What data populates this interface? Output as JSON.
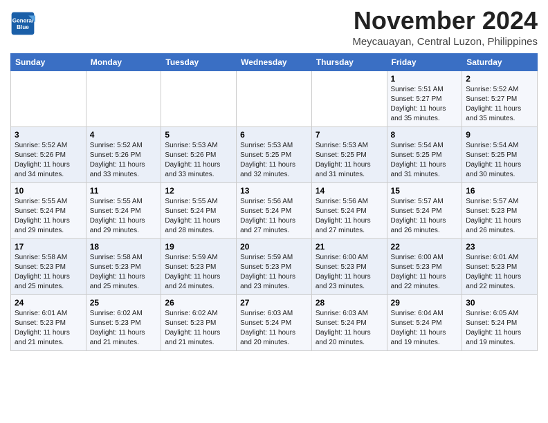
{
  "logo": {
    "line1": "General",
    "line2": "Blue"
  },
  "title": "November 2024",
  "subtitle": "Meycauayan, Central Luzon, Philippines",
  "weekdays": [
    "Sunday",
    "Monday",
    "Tuesday",
    "Wednesday",
    "Thursday",
    "Friday",
    "Saturday"
  ],
  "weeks": [
    [
      {
        "day": "",
        "info": ""
      },
      {
        "day": "",
        "info": ""
      },
      {
        "day": "",
        "info": ""
      },
      {
        "day": "",
        "info": ""
      },
      {
        "day": "",
        "info": ""
      },
      {
        "day": "1",
        "info": "Sunrise: 5:51 AM\nSunset: 5:27 PM\nDaylight: 11 hours\nand 35 minutes."
      },
      {
        "day": "2",
        "info": "Sunrise: 5:52 AM\nSunset: 5:27 PM\nDaylight: 11 hours\nand 35 minutes."
      }
    ],
    [
      {
        "day": "3",
        "info": "Sunrise: 5:52 AM\nSunset: 5:26 PM\nDaylight: 11 hours\nand 34 minutes."
      },
      {
        "day": "4",
        "info": "Sunrise: 5:52 AM\nSunset: 5:26 PM\nDaylight: 11 hours\nand 33 minutes."
      },
      {
        "day": "5",
        "info": "Sunrise: 5:53 AM\nSunset: 5:26 PM\nDaylight: 11 hours\nand 33 minutes."
      },
      {
        "day": "6",
        "info": "Sunrise: 5:53 AM\nSunset: 5:25 PM\nDaylight: 11 hours\nand 32 minutes."
      },
      {
        "day": "7",
        "info": "Sunrise: 5:53 AM\nSunset: 5:25 PM\nDaylight: 11 hours\nand 31 minutes."
      },
      {
        "day": "8",
        "info": "Sunrise: 5:54 AM\nSunset: 5:25 PM\nDaylight: 11 hours\nand 31 minutes."
      },
      {
        "day": "9",
        "info": "Sunrise: 5:54 AM\nSunset: 5:25 PM\nDaylight: 11 hours\nand 30 minutes."
      }
    ],
    [
      {
        "day": "10",
        "info": "Sunrise: 5:55 AM\nSunset: 5:24 PM\nDaylight: 11 hours\nand 29 minutes."
      },
      {
        "day": "11",
        "info": "Sunrise: 5:55 AM\nSunset: 5:24 PM\nDaylight: 11 hours\nand 29 minutes."
      },
      {
        "day": "12",
        "info": "Sunrise: 5:55 AM\nSunset: 5:24 PM\nDaylight: 11 hours\nand 28 minutes."
      },
      {
        "day": "13",
        "info": "Sunrise: 5:56 AM\nSunset: 5:24 PM\nDaylight: 11 hours\nand 27 minutes."
      },
      {
        "day": "14",
        "info": "Sunrise: 5:56 AM\nSunset: 5:24 PM\nDaylight: 11 hours\nand 27 minutes."
      },
      {
        "day": "15",
        "info": "Sunrise: 5:57 AM\nSunset: 5:24 PM\nDaylight: 11 hours\nand 26 minutes."
      },
      {
        "day": "16",
        "info": "Sunrise: 5:57 AM\nSunset: 5:23 PM\nDaylight: 11 hours\nand 26 minutes."
      }
    ],
    [
      {
        "day": "17",
        "info": "Sunrise: 5:58 AM\nSunset: 5:23 PM\nDaylight: 11 hours\nand 25 minutes."
      },
      {
        "day": "18",
        "info": "Sunrise: 5:58 AM\nSunset: 5:23 PM\nDaylight: 11 hours\nand 25 minutes."
      },
      {
        "day": "19",
        "info": "Sunrise: 5:59 AM\nSunset: 5:23 PM\nDaylight: 11 hours\nand 24 minutes."
      },
      {
        "day": "20",
        "info": "Sunrise: 5:59 AM\nSunset: 5:23 PM\nDaylight: 11 hours\nand 23 minutes."
      },
      {
        "day": "21",
        "info": "Sunrise: 6:00 AM\nSunset: 5:23 PM\nDaylight: 11 hours\nand 23 minutes."
      },
      {
        "day": "22",
        "info": "Sunrise: 6:00 AM\nSunset: 5:23 PM\nDaylight: 11 hours\nand 22 minutes."
      },
      {
        "day": "23",
        "info": "Sunrise: 6:01 AM\nSunset: 5:23 PM\nDaylight: 11 hours\nand 22 minutes."
      }
    ],
    [
      {
        "day": "24",
        "info": "Sunrise: 6:01 AM\nSunset: 5:23 PM\nDaylight: 11 hours\nand 21 minutes."
      },
      {
        "day": "25",
        "info": "Sunrise: 6:02 AM\nSunset: 5:23 PM\nDaylight: 11 hours\nand 21 minutes."
      },
      {
        "day": "26",
        "info": "Sunrise: 6:02 AM\nSunset: 5:23 PM\nDaylight: 11 hours\nand 21 minutes."
      },
      {
        "day": "27",
        "info": "Sunrise: 6:03 AM\nSunset: 5:24 PM\nDaylight: 11 hours\nand 20 minutes."
      },
      {
        "day": "28",
        "info": "Sunrise: 6:03 AM\nSunset: 5:24 PM\nDaylight: 11 hours\nand 20 minutes."
      },
      {
        "day": "29",
        "info": "Sunrise: 6:04 AM\nSunset: 5:24 PM\nDaylight: 11 hours\nand 19 minutes."
      },
      {
        "day": "30",
        "info": "Sunrise: 6:05 AM\nSunset: 5:24 PM\nDaylight: 11 hours\nand 19 minutes."
      }
    ]
  ]
}
